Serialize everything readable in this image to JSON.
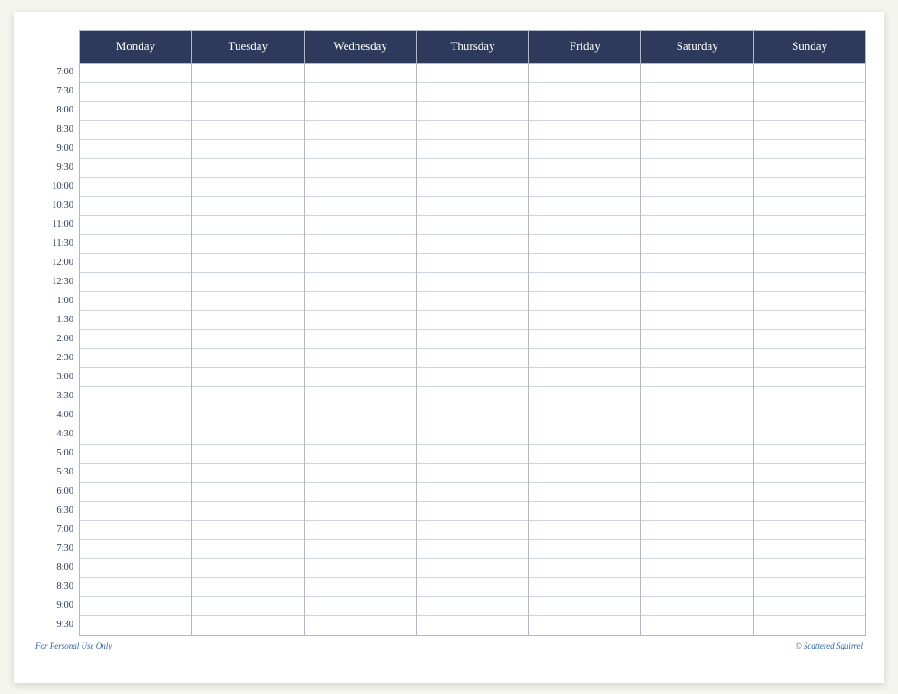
{
  "header": {
    "days": [
      "Monday",
      "Tuesday",
      "Wednesday",
      "Thursday",
      "Friday",
      "Saturday",
      "Sunday"
    ]
  },
  "times": [
    "7:00",
    "7:30",
    "8:00",
    "8:30",
    "9:00",
    "9:30",
    "10:00",
    "10:30",
    "11:00",
    "11:30",
    "12:00",
    "12:30",
    "1:00",
    "1:30",
    "2:00",
    "2:30",
    "3:00",
    "3:30",
    "4:00",
    "4:30",
    "5:00",
    "5:30",
    "6:00",
    "6:30",
    "7:00",
    "7:30",
    "8:00",
    "8:30",
    "9:00",
    "9:30"
  ],
  "footer": {
    "left": "For Personal Use Only",
    "right": "© Scattered Squirrel"
  }
}
